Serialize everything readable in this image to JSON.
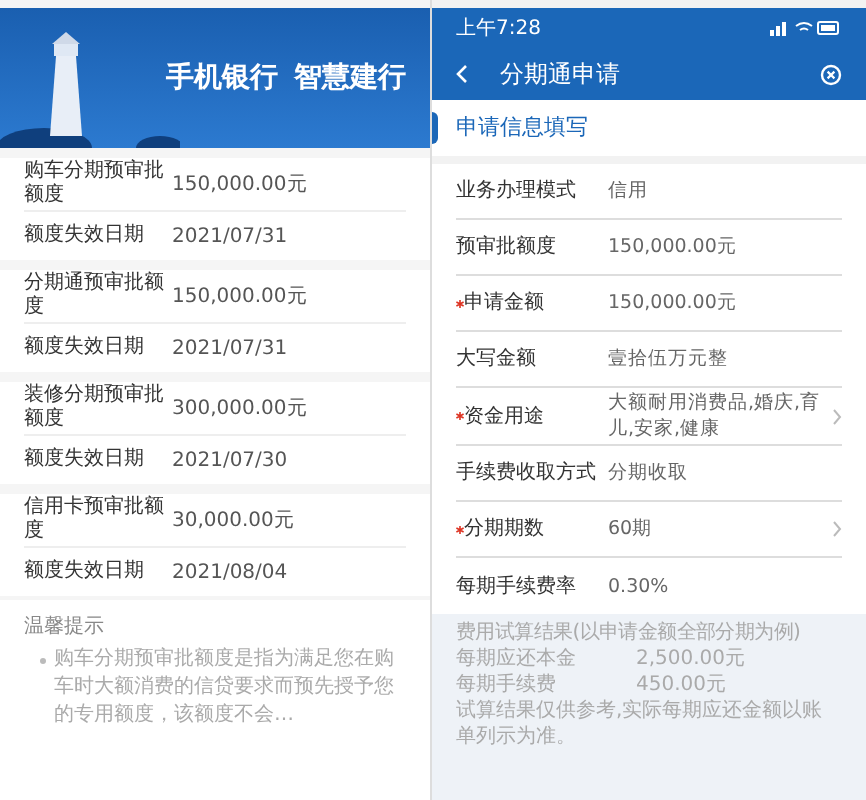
{
  "left": {
    "banner": {
      "title": [
        "手机银行",
        "智慧建行"
      ]
    },
    "sections": [
      {
        "rows": [
          {
            "label": "购车分期预审批额度",
            "value": "150,000.00元"
          },
          {
            "label": "额度失效日期",
            "value": "2021/07/31"
          }
        ]
      },
      {
        "rows": [
          {
            "label": "分期通预审批额度",
            "value": "150,000.00元"
          },
          {
            "label": "额度失效日期",
            "value": "2021/07/31"
          }
        ]
      },
      {
        "rows": [
          {
            "label": "装修分期预审批额度",
            "value": "300,000.00元"
          },
          {
            "label": "额度失效日期",
            "value": "2021/07/30"
          }
        ]
      },
      {
        "rows": [
          {
            "label": "信用卡预审批额度",
            "value": "30,000.00元"
          },
          {
            "label": "额度失效日期",
            "value": "2021/08/04"
          }
        ]
      }
    ],
    "tips": {
      "title": "温馨提示",
      "items": [
        "购车分期预审批额度是指为满足您在购车时大额消费的信贷要求而预先授予您的专用额度，该额度不会…"
      ]
    }
  },
  "right": {
    "status_bar": {
      "time": "上午7:28"
    },
    "header": {
      "title": "分期通申请"
    },
    "section_title": "申请信息填写",
    "fields": [
      {
        "label": "业务办理模式",
        "value": "信用",
        "required": false,
        "chevron": false
      },
      {
        "label": "预审批额度",
        "value": "150,000.00元",
        "required": false,
        "chevron": false
      },
      {
        "label": "申请金额",
        "value": "150,000.00元",
        "required": true,
        "chevron": false
      },
      {
        "label": "大写金额",
        "value": "壹拾伍万元整",
        "required": false,
        "chevron": false
      },
      {
        "label": "资金用途",
        "value": "大额耐用消费品,婚庆,育儿,安家,健康",
        "required": true,
        "chevron": true
      },
      {
        "label": "手续费收取方式",
        "value": "分期收取",
        "required": false,
        "chevron": false
      },
      {
        "label": "分期期数",
        "value": "60期",
        "required": true,
        "chevron": true
      },
      {
        "label": "每期手续费率",
        "value": "0.30%",
        "required": false,
        "chevron": false
      }
    ],
    "estimate": {
      "title": "费用试算结果(以申请金额全部分期为例)",
      "rows": [
        {
          "label": "每期应还本金",
          "value": "2,500.00元"
        },
        {
          "label": "每期手续费",
          "value": "450.00元"
        }
      ],
      "note": "试算结果仅供参考,实际每期应还金额以账单列示为准。"
    }
  }
}
